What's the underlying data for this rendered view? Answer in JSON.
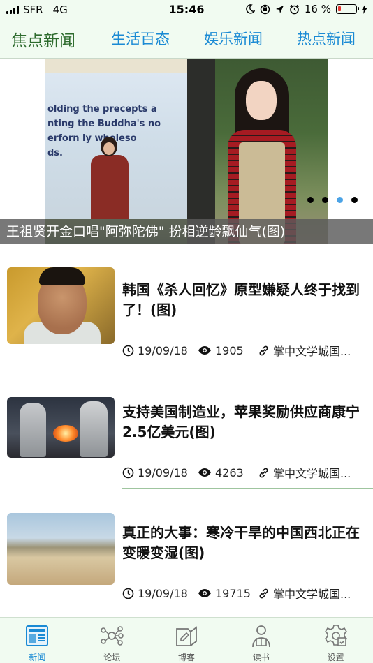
{
  "status_bar": {
    "carrier": "SFR",
    "network": "4G",
    "time": "15:46",
    "battery_percent": "16 %",
    "battery_level": 0.16,
    "battery_color": "#e53935"
  },
  "tabs": [
    {
      "label": "焦点新闻",
      "active": true
    },
    {
      "label": "生活百态",
      "active": false
    },
    {
      "label": "娱乐新闻",
      "active": false
    },
    {
      "label": "热点新闻",
      "active": false
    }
  ],
  "banner": {
    "slide_text": [
      "olding the precepts a",
      "nting the Buddha's no",
      "erforn   ly wholeso",
      "ds."
    ],
    "caption": "王祖贤开金口唱\"阿弥陀佛\" 扮相逆龄飘仙气(图)",
    "dots_total": 4,
    "active_dot": 2,
    "active_dot_color": "#4ba3e6"
  },
  "news": [
    {
      "title": "韩国《杀人回忆》原型嫌疑人终于找到了！(图)",
      "date": "19/09/18",
      "views": "1905",
      "source": "掌中文学城国...",
      "thumb_icon": "portrait-photo"
    },
    {
      "title": "支持美国制造业，苹果奖励供应商康宁2.5亿美元(图)",
      "date": "19/09/18",
      "views": "4263",
      "source": "掌中文学城国...",
      "thumb_icon": "factory-photo"
    },
    {
      "title": "真正的大事：寒冷干旱的中国西北正在变暖变湿(图)",
      "date": "19/09/18",
      "views": "19715",
      "source": "掌中文学城国...",
      "thumb_icon": "desert-photo"
    }
  ],
  "bottom_nav": [
    {
      "label": "新闻",
      "icon": "newspaper-icon",
      "active": true
    },
    {
      "label": "论坛",
      "icon": "forum-network-icon",
      "active": false
    },
    {
      "label": "博客",
      "icon": "blog-book-icon",
      "active": false
    },
    {
      "label": "读书",
      "icon": "reader-person-icon",
      "active": false
    },
    {
      "label": "设置",
      "icon": "settings-gear-icon",
      "active": false
    }
  ],
  "colors": {
    "accent_blue": "#1a8ad4",
    "active_tab_green": "#2e6b2e",
    "header_bg": "#f1fbf1",
    "divider_green": "#9fc59f"
  }
}
